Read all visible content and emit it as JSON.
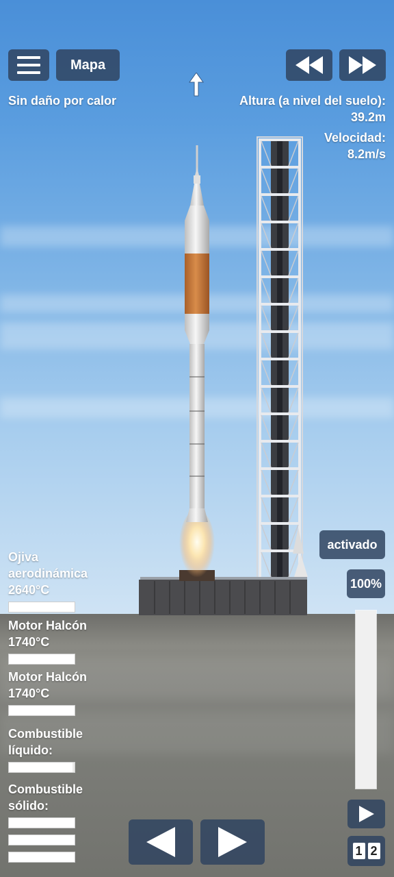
{
  "top_bar": {
    "menu_icon": "hamburger-icon",
    "map_label": "Mapa",
    "rewind_icon": "rewind-icon",
    "fast_forward_icon": "fast-forward-icon",
    "heading_icon": "up-arrow-icon"
  },
  "status": {
    "heat_damage": "Sin daño por calor",
    "altitude_label": "Altura (a nivel del suelo):",
    "altitude_value": "39.2m",
    "velocity_label": "Velocidad:",
    "velocity_value": "8.2m/s"
  },
  "parts": [
    {
      "name_line1": "Ojiva",
      "name_line2": "aerodinámica",
      "temp": "2640°C",
      "level": 1.0
    },
    {
      "name_line1": "Motor Halcón",
      "temp": "1740°C",
      "level": 1.0
    },
    {
      "name_line1": "Motor Halcón",
      "temp": "1740°C",
      "level": 1.0
    }
  ],
  "fuel": {
    "liquid_line1": "Combustible",
    "liquid_line2": "líquido:",
    "liquid_level": 0.97,
    "solid_line1": "Combustible",
    "solid_line2": "sólido:",
    "solid_levels": [
      1.0,
      1.0,
      1.0
    ]
  },
  "controls": {
    "activated_label": "activado",
    "throttle_label": "100%",
    "throttle_level": 1.0,
    "rotate_left_icon": "triangle-left-icon",
    "rotate_right_icon": "triangle-right-icon",
    "play_icon": "play-icon",
    "stage_digits": [
      "1",
      "2"
    ]
  },
  "colors": {
    "button_bg": "#304460",
    "sky_top": "#4a8fd8",
    "ground": "#7e7f7a",
    "fuel_tank": "#c8783a"
  }
}
